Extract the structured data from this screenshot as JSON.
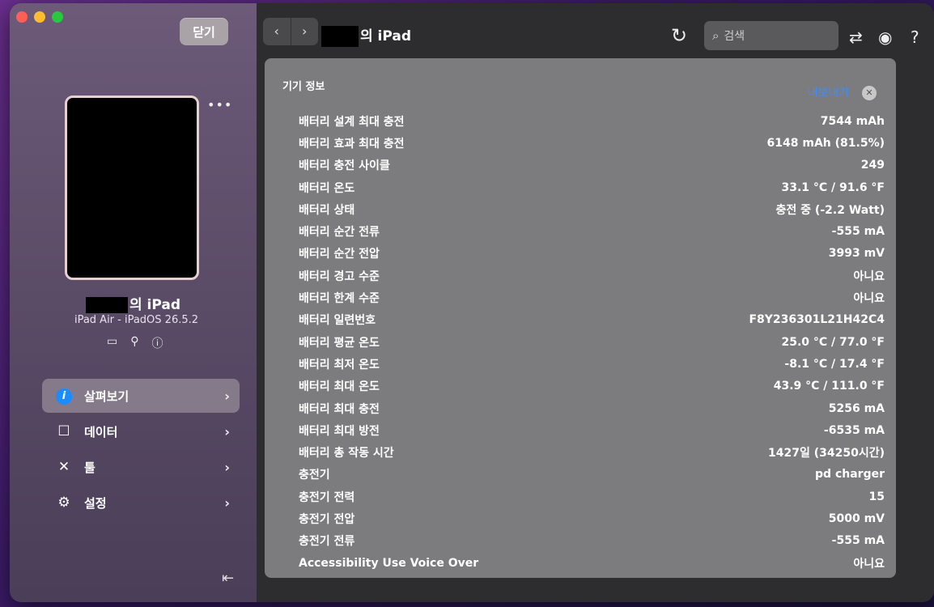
{
  "window": {
    "close_label": "닫기"
  },
  "device": {
    "name_suffix": "의 iPad",
    "model": "iPad Air - iPadOS 26.5.2"
  },
  "nav": {
    "items": [
      {
        "label": "살펴보기",
        "icon": "info-icon",
        "active": true
      },
      {
        "label": "데이터",
        "icon": "square-icon",
        "active": false
      },
      {
        "label": "툴",
        "icon": "tools-icon",
        "active": false
      },
      {
        "label": "설정",
        "icon": "gear-icon",
        "active": false
      }
    ]
  },
  "toolbar": {
    "title_suffix": "의 iPad",
    "search_placeholder": "검색"
  },
  "panel": {
    "title": "기기 정보",
    "export_label": "내보내기",
    "rows": [
      {
        "label": "배터리 설계 최대 충전",
        "value": "7544 mAh"
      },
      {
        "label": "배터리 효과 최대 충전",
        "value": "6148 mAh (81.5%)"
      },
      {
        "label": "배터리 충전 사이클",
        "value": "249"
      },
      {
        "label": "배터리 온도",
        "value": "33.1 °C / 91.6 °F"
      },
      {
        "label": "배터리 상태",
        "value": "충전 중 (-2.2 Watt)"
      },
      {
        "label": "배터리 순간 전류",
        "value": "-555 mA"
      },
      {
        "label": "배터리 순간 전압",
        "value": "3993 mV"
      },
      {
        "label": "배터리 경고 수준",
        "value": "아니요"
      },
      {
        "label": "배터리 한계 수준",
        "value": "아니요"
      },
      {
        "label": "배터리 일련번호",
        "value": "F8Y236301L21H42C4"
      },
      {
        "label": "배터리 평균 온도",
        "value": "25.0 °C / 77.0 °F"
      },
      {
        "label": "배터리 최저 온도",
        "value": "-8.1 °C / 17.4 °F"
      },
      {
        "label": "배터리 최대 온도",
        "value": "43.9 °C / 111.0 °F"
      },
      {
        "label": "배터리 최대 충전",
        "value": "5256 mA"
      },
      {
        "label": "배터리 최대 방전",
        "value": "-6535 mA"
      },
      {
        "label": "배터리 총 작동 시간",
        "value": "1427일 (34250시간)"
      },
      {
        "label": "충전기",
        "value": "pd charger"
      },
      {
        "label": "충전기 전력",
        "value": "15"
      },
      {
        "label": "충전기 전압",
        "value": "5000 mV"
      },
      {
        "label": "충전기 전류",
        "value": "-555 mA"
      },
      {
        "label": "Accessibility Use Voice Over",
        "value": "아니요"
      }
    ]
  }
}
